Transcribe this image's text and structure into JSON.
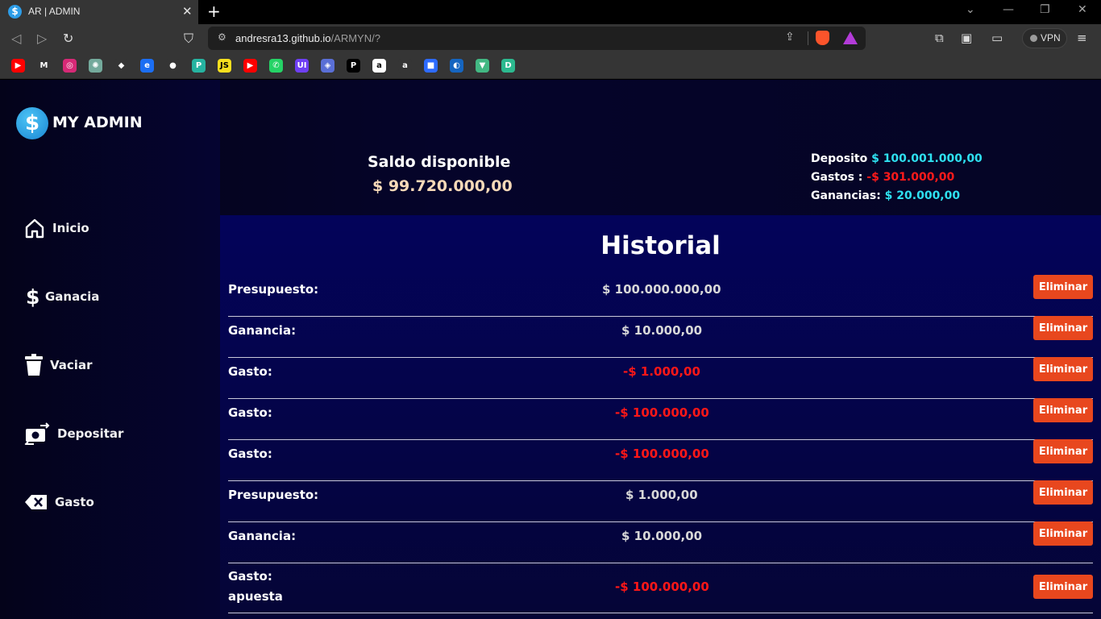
{
  "browser": {
    "tab_title": "AR | ADMIN",
    "tab_favicon": "$",
    "url_host": "andresra13.github.io",
    "url_path": "/ARMYN/?",
    "vpn_label": "VPN",
    "bookmarks": [
      {
        "name": "youtube",
        "glyph": "▶",
        "color": "#ff0000"
      },
      {
        "name": "gmail",
        "glyph": "M",
        "color": "#353535"
      },
      {
        "name": "instagram",
        "glyph": "◎",
        "color": "#d62976"
      },
      {
        "name": "chatgpt",
        "glyph": "✺",
        "color": "#74aa9c"
      },
      {
        "name": "gitlab",
        "glyph": "◆",
        "color": "#353535"
      },
      {
        "name": "edge",
        "glyph": "e",
        "color": "#1b6ef3"
      },
      {
        "name": "github",
        "glyph": "●",
        "color": "#353535"
      },
      {
        "name": "replit",
        "glyph": "P",
        "color": "#26b3a0"
      },
      {
        "name": "javascript",
        "glyph": "JS",
        "color": "#f7df1e"
      },
      {
        "name": "youtube-2",
        "glyph": "▶",
        "color": "#ff0000"
      },
      {
        "name": "whatsapp",
        "glyph": "✆",
        "color": "#25d366"
      },
      {
        "name": "uiverse",
        "glyph": "UI",
        "color": "#6e3ff3"
      },
      {
        "name": "bookmark-app",
        "glyph": "◈",
        "color": "#5a6fd6"
      },
      {
        "name": "pinterest-p",
        "glyph": "P",
        "color": "#000000"
      },
      {
        "name": "amazon",
        "glyph": "a",
        "color": "#ffffff"
      },
      {
        "name": "amazon-2",
        "glyph": "a",
        "color": "#353535"
      },
      {
        "name": "blue-app",
        "glyph": "■",
        "color": "#2d6bff"
      },
      {
        "name": "globe-app",
        "glyph": "◐",
        "color": "#1565c0"
      },
      {
        "name": "vue",
        "glyph": "▼",
        "color": "#42b883"
      },
      {
        "name": "green-app",
        "glyph": "D",
        "color": "#2cb98f"
      }
    ]
  },
  "app": {
    "logo_symbol": "$",
    "logo_text": "MY ADMIN",
    "menu": [
      {
        "id": "inicio",
        "label": "Inicio"
      },
      {
        "id": "ganacia",
        "label": "Ganacia"
      },
      {
        "id": "vaciar",
        "label": "Vaciar"
      },
      {
        "id": "depositar",
        "label": "Depositar"
      },
      {
        "id": "gasto",
        "label": "Gasto"
      }
    ],
    "balance": {
      "title": "Saldo disponible",
      "value": "$ 99.720.000,00"
    },
    "summary": {
      "deposito_label": "Deposito",
      "deposito_value": "$ 100.001.000,00",
      "gastos_label": "Gastos :",
      "gastos_value": "-$ 301.000,00",
      "ganancias_label": "Ganancias:",
      "ganancias_value": "$ 20.000,00"
    },
    "history": {
      "title": "Historial",
      "delete_label": "Eliminar",
      "rows": [
        {
          "label": "Presupuesto:",
          "sublabel": "",
          "amount": "$ 100.000.000,00",
          "negative": false
        },
        {
          "label": "Ganancia:",
          "sublabel": "",
          "amount": "$ 10.000,00",
          "negative": false
        },
        {
          "label": "Gasto:",
          "sublabel": "",
          "amount": "-$ 1.000,00",
          "negative": true
        },
        {
          "label": "Gasto:",
          "sublabel": "",
          "amount": "-$ 100.000,00",
          "negative": true
        },
        {
          "label": "Gasto:",
          "sublabel": "",
          "amount": "-$ 100.000,00",
          "negative": true
        },
        {
          "label": "Presupuesto:",
          "sublabel": "",
          "amount": "$ 1.000,00",
          "negative": false
        },
        {
          "label": "Ganancia:",
          "sublabel": "",
          "amount": "$ 10.000,00",
          "negative": false
        },
        {
          "label": "Gasto:",
          "sublabel": "apuesta",
          "amount": "-$ 100.000,00",
          "negative": true
        }
      ]
    }
  }
}
